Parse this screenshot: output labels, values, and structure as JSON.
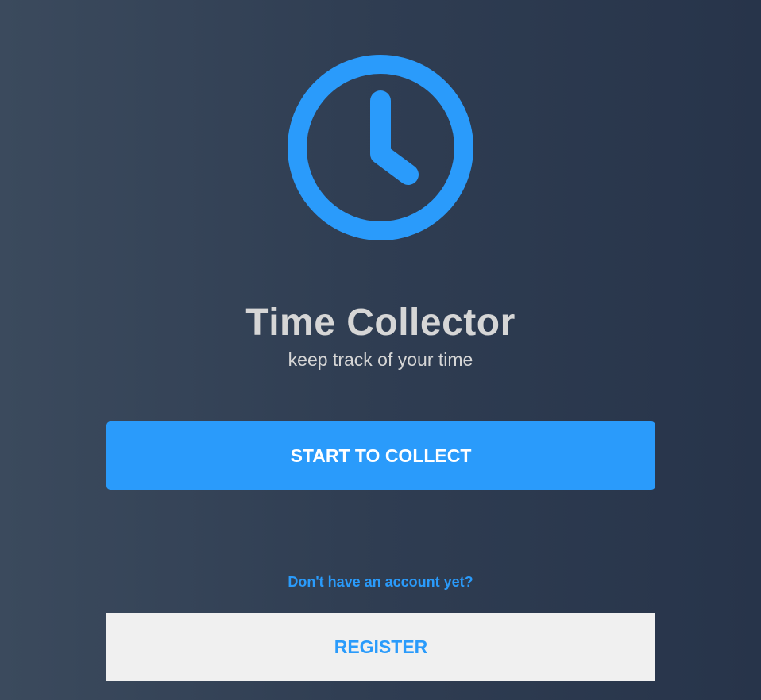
{
  "app": {
    "title": "Time Collector",
    "subtitle": "keep track of your time",
    "logo_icon": "clock-icon"
  },
  "actions": {
    "start_label": "START TO COLLECT",
    "account_prompt": "Don't have an account yet?",
    "register_label": "REGISTER"
  },
  "colors": {
    "accent": "#2a9bfb",
    "background_start": "#3b4a5d",
    "background_end": "#27344a",
    "text_light": "#d6d6d6",
    "secondary_button_bg": "#f0f0f0"
  }
}
